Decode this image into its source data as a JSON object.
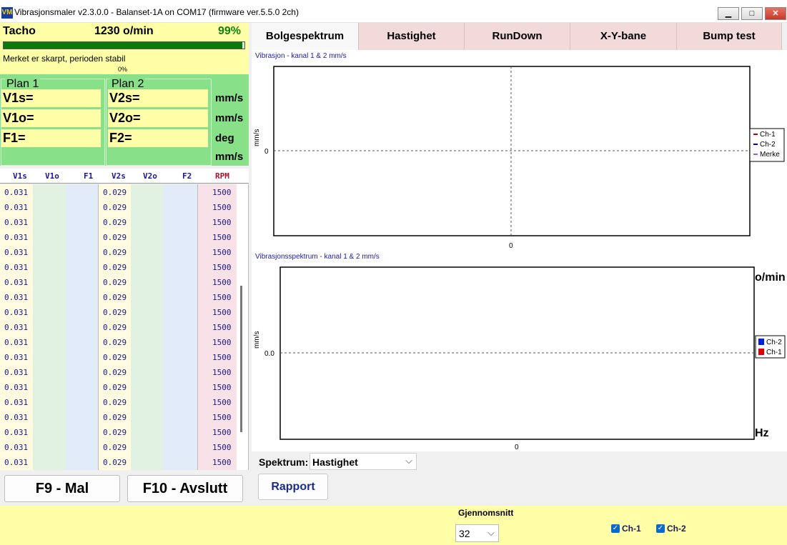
{
  "window": {
    "title": "Vibrasjonsmaler v2.3.0.0 - Balanset-1A on COM17 (firmware ver.5.5.0 2ch)",
    "icon_letters": "VM",
    "min_glyph": "▁",
    "max_glyph": "□",
    "close_glyph": "✕"
  },
  "tacho": {
    "label": "Tacho",
    "rpm": "1230 o/min",
    "percent": "99%",
    "progress": 0.99,
    "message": "Merket er skarpt, perioden stabil",
    "zero_label": "0%"
  },
  "planes": {
    "plan1_title": "Plan 1",
    "plan2_title": "Plan 2",
    "v1s": "V1s=",
    "v1o": "V1o=",
    "f1": "F1=",
    "v2s": "V2s=",
    "v2o": "V2o=",
    "f2": "F2=",
    "units": [
      "mm/s",
      "mm/s",
      "deg",
      "mm/s"
    ]
  },
  "table": {
    "headers": [
      "V1s",
      "V1o",
      "F1",
      "V2s",
      "V2o",
      "F2",
      "RPM"
    ],
    "rows": [
      [
        "0.031",
        "0.029",
        "1500"
      ],
      [
        "0.031",
        "0.029",
        "1500"
      ],
      [
        "0.031",
        "0.029",
        "1500"
      ],
      [
        "0.031",
        "0.029",
        "1500"
      ],
      [
        "0.031",
        "0.029",
        "1500"
      ],
      [
        "0.031",
        "0.029",
        "1500"
      ],
      [
        "0.031",
        "0.029",
        "1500"
      ],
      [
        "0.031",
        "0.029",
        "1500"
      ],
      [
        "0.031",
        "0.029",
        "1500"
      ],
      [
        "0.031",
        "0.029",
        "1500"
      ],
      [
        "0.031",
        "0.029",
        "1500"
      ],
      [
        "0.031",
        "0.029",
        "1500"
      ],
      [
        "0.031",
        "0.029",
        "1500"
      ],
      [
        "0.031",
        "0.029",
        "1500"
      ],
      [
        "0.031",
        "0.029",
        "1500"
      ],
      [
        "0.031",
        "0.029",
        "1500"
      ],
      [
        "0.031",
        "0.029",
        "1500"
      ],
      [
        "0.031",
        "0.029",
        "1500"
      ],
      [
        "0.031",
        "0.029",
        "1500"
      ]
    ]
  },
  "buttons": {
    "f9": "F9 - Mal",
    "f10": "F10 - Avslutt",
    "report": "Rapport"
  },
  "tabs": [
    "Bolgespektrum",
    "Hastighet",
    "RunDown",
    "X-Y-bane",
    "Bump test"
  ],
  "active_tab": 0,
  "chart_top": {
    "title": "Vibrasjon  - kanal 1 & 2 mm/s",
    "ylabel": "mm/s",
    "y_tick": "0",
    "x_tick": "0",
    "legend": [
      "Ch-1",
      "Ch-2",
      "Merke"
    ],
    "legend_colors": [
      "#c00000",
      "#0000c0",
      "#9060e0"
    ]
  },
  "chart_bottom": {
    "title": "Vibrasjonsspektrum  - kanal 1 & 2 mm/s",
    "ylabel": "mm/s",
    "y_tick": "0.0",
    "x_tick": "0",
    "right_unit_top": "o/min",
    "right_unit_bottom": "Hz",
    "legend": [
      "Ch-2",
      "Ch-1"
    ],
    "legend_colors": [
      "#0020e0",
      "#e00000"
    ]
  },
  "spectrum": {
    "label": "Spektrum:",
    "value": "Hastighet",
    "chevron": "⌵"
  },
  "averaging": {
    "label": "Gjennomsnitt",
    "value": "32",
    "chevron": "⌵"
  },
  "channels": {
    "ch1": "Ch-1",
    "ch2": "Ch-2",
    "check": "✓"
  }
}
